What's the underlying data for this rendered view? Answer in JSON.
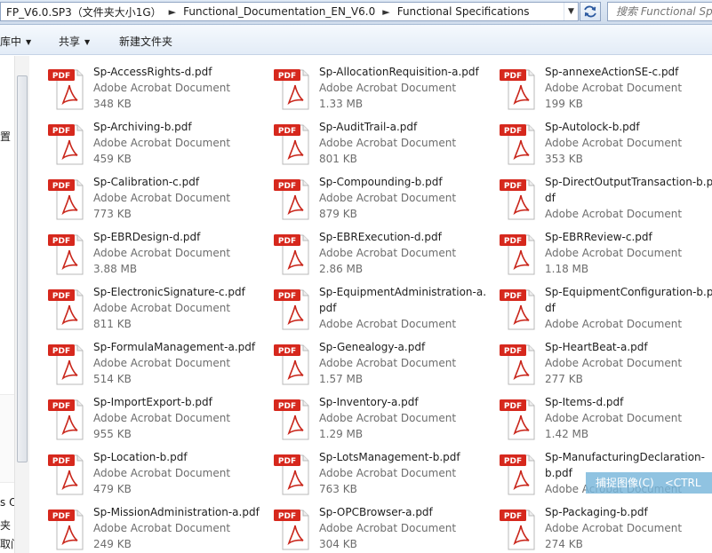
{
  "address": {
    "crumbs": [
      "FP_V6.0.SP3（文件夹大小1G）",
      "Functional_Documentation_EN_V6.0",
      "Functional Specifications"
    ],
    "search_placeholder": "搜索 Functional Spec"
  },
  "toolbar": {
    "library_label": "库中",
    "share_label": "共享",
    "new_folder_label": "新建文件夹"
  },
  "nav": {
    "items": [
      "置",
      "s O",
      "夹",
      "取门"
    ]
  },
  "files": [
    {
      "name": "Sp-AccessRights-d.pdf",
      "type": "Adobe Acrobat Document",
      "size": "348 KB"
    },
    {
      "name": "Sp-AllocationRequisition-a.pdf",
      "type": "Adobe Acrobat Document",
      "size": "1.33 MB"
    },
    {
      "name": "Sp-annexeActionSE-c.pdf",
      "type": "Adobe Acrobat Document",
      "size": "199 KB"
    },
    {
      "name": "Sp-Archiving-b.pdf",
      "type": "Adobe Acrobat Document",
      "size": "459 KB"
    },
    {
      "name": "Sp-AuditTrail-a.pdf",
      "type": "Adobe Acrobat Document",
      "size": "801 KB"
    },
    {
      "name": "Sp-Autolock-b.pdf",
      "type": "Adobe Acrobat Document",
      "size": "353 KB"
    },
    {
      "name": "Sp-Calibration-c.pdf",
      "type": "Adobe Acrobat Document",
      "size": "773 KB"
    },
    {
      "name": "Sp-Compounding-b.pdf",
      "type": "Adobe Acrobat Document",
      "size": "879 KB"
    },
    {
      "name": "Sp-DirectOutputTransaction-b.pdf",
      "type": "Adobe Acrobat Document",
      "size": ""
    },
    {
      "name": "Sp-EBRDesign-d.pdf",
      "type": "Adobe Acrobat Document",
      "size": "3.88 MB"
    },
    {
      "name": "Sp-EBRExecution-d.pdf",
      "type": "Adobe Acrobat Document",
      "size": "2.86 MB"
    },
    {
      "name": "Sp-EBRReview-c.pdf",
      "type": "Adobe Acrobat Document",
      "size": "1.18 MB"
    },
    {
      "name": "Sp-ElectronicSignature-c.pdf",
      "type": "Adobe Acrobat Document",
      "size": "811 KB"
    },
    {
      "name": "Sp-EquipmentAdministration-a.pdf",
      "type": "Adobe Acrobat Document",
      "size": ""
    },
    {
      "name": "Sp-EquipmentConfiguration-b.pdf",
      "type": "Adobe Acrobat Document",
      "size": ""
    },
    {
      "name": "Sp-FormulaManagement-a.pdf",
      "type": "Adobe Acrobat Document",
      "size": "514 KB"
    },
    {
      "name": "Sp-Genealogy-a.pdf",
      "type": "Adobe Acrobat Document",
      "size": "1.57 MB"
    },
    {
      "name": "Sp-HeartBeat-a.pdf",
      "type": "Adobe Acrobat Document",
      "size": "277 KB"
    },
    {
      "name": "Sp-ImportExport-b.pdf",
      "type": "Adobe Acrobat Document",
      "size": "955 KB"
    },
    {
      "name": "Sp-Inventory-a.pdf",
      "type": "Adobe Acrobat Document",
      "size": "1.29 MB"
    },
    {
      "name": "Sp-Items-d.pdf",
      "type": "Adobe Acrobat Document",
      "size": "1.42 MB"
    },
    {
      "name": "Sp-Location-b.pdf",
      "type": "Adobe Acrobat Document",
      "size": "479 KB"
    },
    {
      "name": "Sp-LotsManagement-b.pdf",
      "type": "Adobe Acrobat Document",
      "size": "763 KB"
    },
    {
      "name": "Sp-ManufacturingDeclaration-b.pdf",
      "type": "Adobe Acrobat Document",
      "size": ""
    },
    {
      "name": "Sp-MissionAdministration-a.pdf",
      "type": "Adobe Acrobat Document",
      "size": "249 KB"
    },
    {
      "name": "Sp-OPCBrowser-a.pdf",
      "type": "Adobe Acrobat Document",
      "size": "304 KB"
    },
    {
      "name": "Sp-Packaging-b.pdf",
      "type": "Adobe Acrobat Document",
      "size": "274 KB"
    }
  ],
  "file_icon": {
    "name": "pdf-file-icon",
    "badge": "PDF",
    "badge_color": "#d6281d",
    "accent": "#c9251a"
  },
  "overlay": {
    "capture_text": "捕捉图像(C)　<CTRL"
  }
}
